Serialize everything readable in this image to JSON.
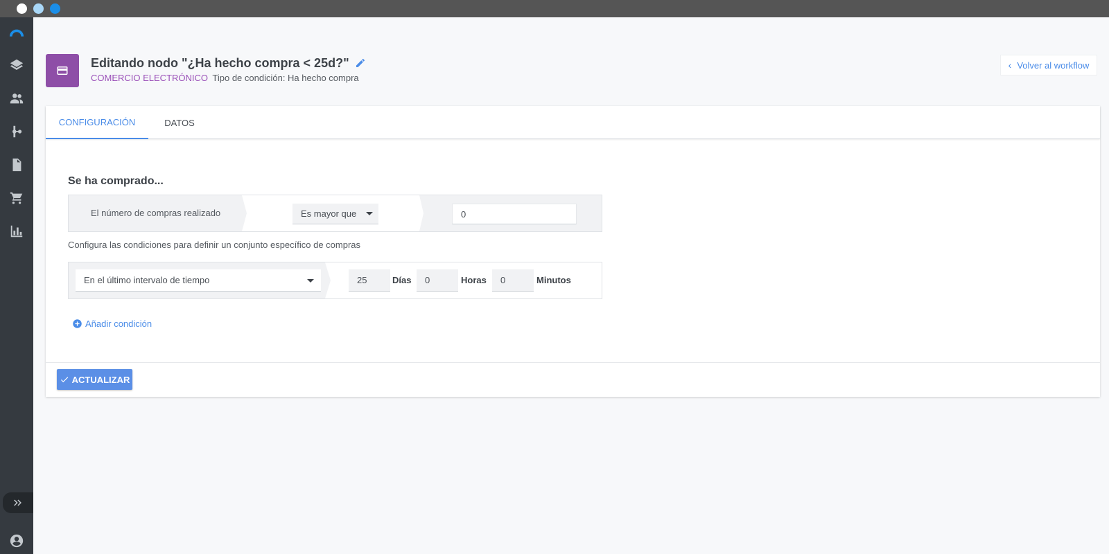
{
  "window": {
    "controls": [
      "close",
      "minimize",
      "maximize"
    ],
    "colors": {
      "close": "#ffffff",
      "minimize": "#a9d7f7",
      "maximize": "#1b8ee8"
    }
  },
  "sidebar": {
    "items": [
      {
        "icon": "logo-icon"
      },
      {
        "icon": "layers-icon"
      },
      {
        "icon": "people-icon"
      },
      {
        "icon": "workflow-icon"
      },
      {
        "icon": "document-icon"
      },
      {
        "icon": "cart-icon"
      },
      {
        "icon": "bar-chart-icon"
      }
    ],
    "expand_icon": "double-chevron-right-icon",
    "user_icon": "account-circle-icon"
  },
  "header": {
    "icon": "credit-card-icon",
    "icon_bg_color": "#8e4ea7",
    "title": "Editando nodo \"¿Ha hecho compra < 25d?\"",
    "category": "COMERCIO ELECTRÓNICO",
    "condition_type": "Tipo de condición: Ha hecho compra",
    "back_label": "Volver al workflow"
  },
  "tabs": [
    {
      "label": "CONFIGURACIÓN",
      "active": true
    },
    {
      "label": "DATOS",
      "active": false
    }
  ],
  "form": {
    "section_title": "Se ha comprado...",
    "condition_label": "El número de compras realizado",
    "operator": "Es mayor que",
    "value": "0",
    "hint": "Configura las condiciones para definir un conjunto específico de compras",
    "interval_select": "En el último intervalo de tiempo",
    "days": "25",
    "days_label": "Días",
    "hours": "0",
    "hours_label": "Horas",
    "minutes": "0",
    "minutes_label": "Minutos",
    "add_condition": "Añadir condición"
  },
  "footer": {
    "update_label": "ACTUALIZAR"
  },
  "colors": {
    "accent": "#4a8ce8",
    "category": "#9a4fb8",
    "sidebar_bg": "#353a40"
  }
}
